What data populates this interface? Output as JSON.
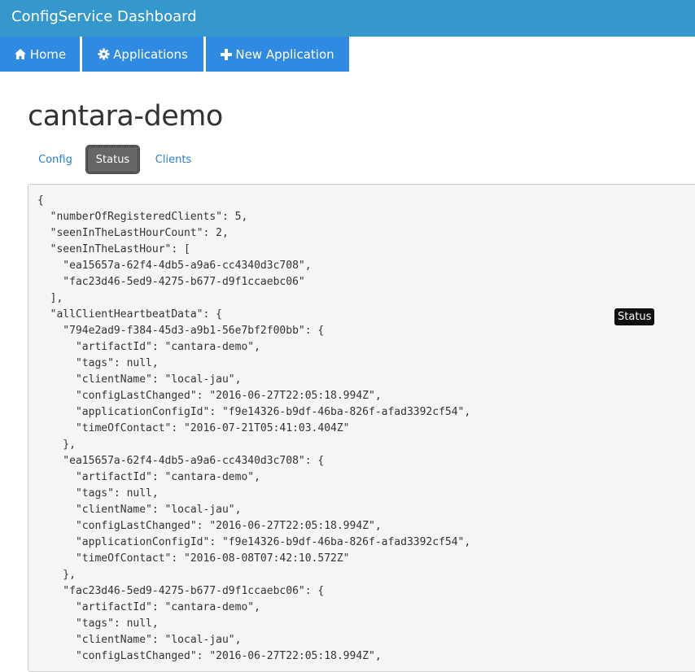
{
  "header": {
    "brand": "ConfigService Dashboard"
  },
  "nav": {
    "home": "Home",
    "applications": "Applications",
    "new_application": "New Application",
    "icons": [
      "home-icon",
      "gear-icon",
      "plus-icon"
    ]
  },
  "page": {
    "title": "cantara-demo"
  },
  "tabs": {
    "config": "Config",
    "status": "Status",
    "clients": "Clients",
    "active": "Status"
  },
  "status_json": "{\n  \"numberOfRegisteredClients\": 5,\n  \"seenInTheLastHourCount\": 2,\n  \"seenInTheLastHour\": [\n    \"ea15657a-62f4-4db5-a9a6-cc4340d3c708\",\n    \"fac23d46-5ed9-4275-b677-d9f1ccaebc06\"\n  ],\n  \"allClientHeartbeatData\": {\n    \"794e2ad9-f384-45d3-a9b1-56e7bf2f00bb\": {\n      \"artifactId\": \"cantara-demo\",\n      \"tags\": null,\n      \"clientName\": \"local-jau\",\n      \"configLastChanged\": \"2016-06-27T22:05:18.994Z\",\n      \"applicationConfigId\": \"f9e14326-b9df-46ba-826f-afad3392cf54\",\n      \"timeOfContact\": \"2016-07-21T05:41:03.404Z\"\n    },\n    \"ea15657a-62f4-4db5-a9a6-cc4340d3c708\": {\n      \"artifactId\": \"cantara-demo\",\n      \"tags\": null,\n      \"clientName\": \"local-jau\",\n      \"configLastChanged\": \"2016-06-27T22:05:18.994Z\",\n      \"applicationConfigId\": \"f9e14326-b9df-46ba-826f-afad3392cf54\",\n      \"timeOfContact\": \"2016-08-08T07:42:10.572Z\"\n    },\n    \"fac23d46-5ed9-4275-b677-d9f1ccaebc06\": {\n      \"artifactId\": \"cantara-demo\",\n      \"tags\": null,\n      \"clientName\": \"local-jau\",\n      \"configLastChanged\": \"2016-06-27T22:05:18.994Z\",",
  "tooltip": {
    "text": "Status"
  },
  "colors": {
    "header_bg": "#3498cc",
    "nav_bg": "#2f8ae2",
    "active_tab_bg": "#666666",
    "link": "#2a7fc9",
    "panel_bg": "#f5f5f5"
  }
}
